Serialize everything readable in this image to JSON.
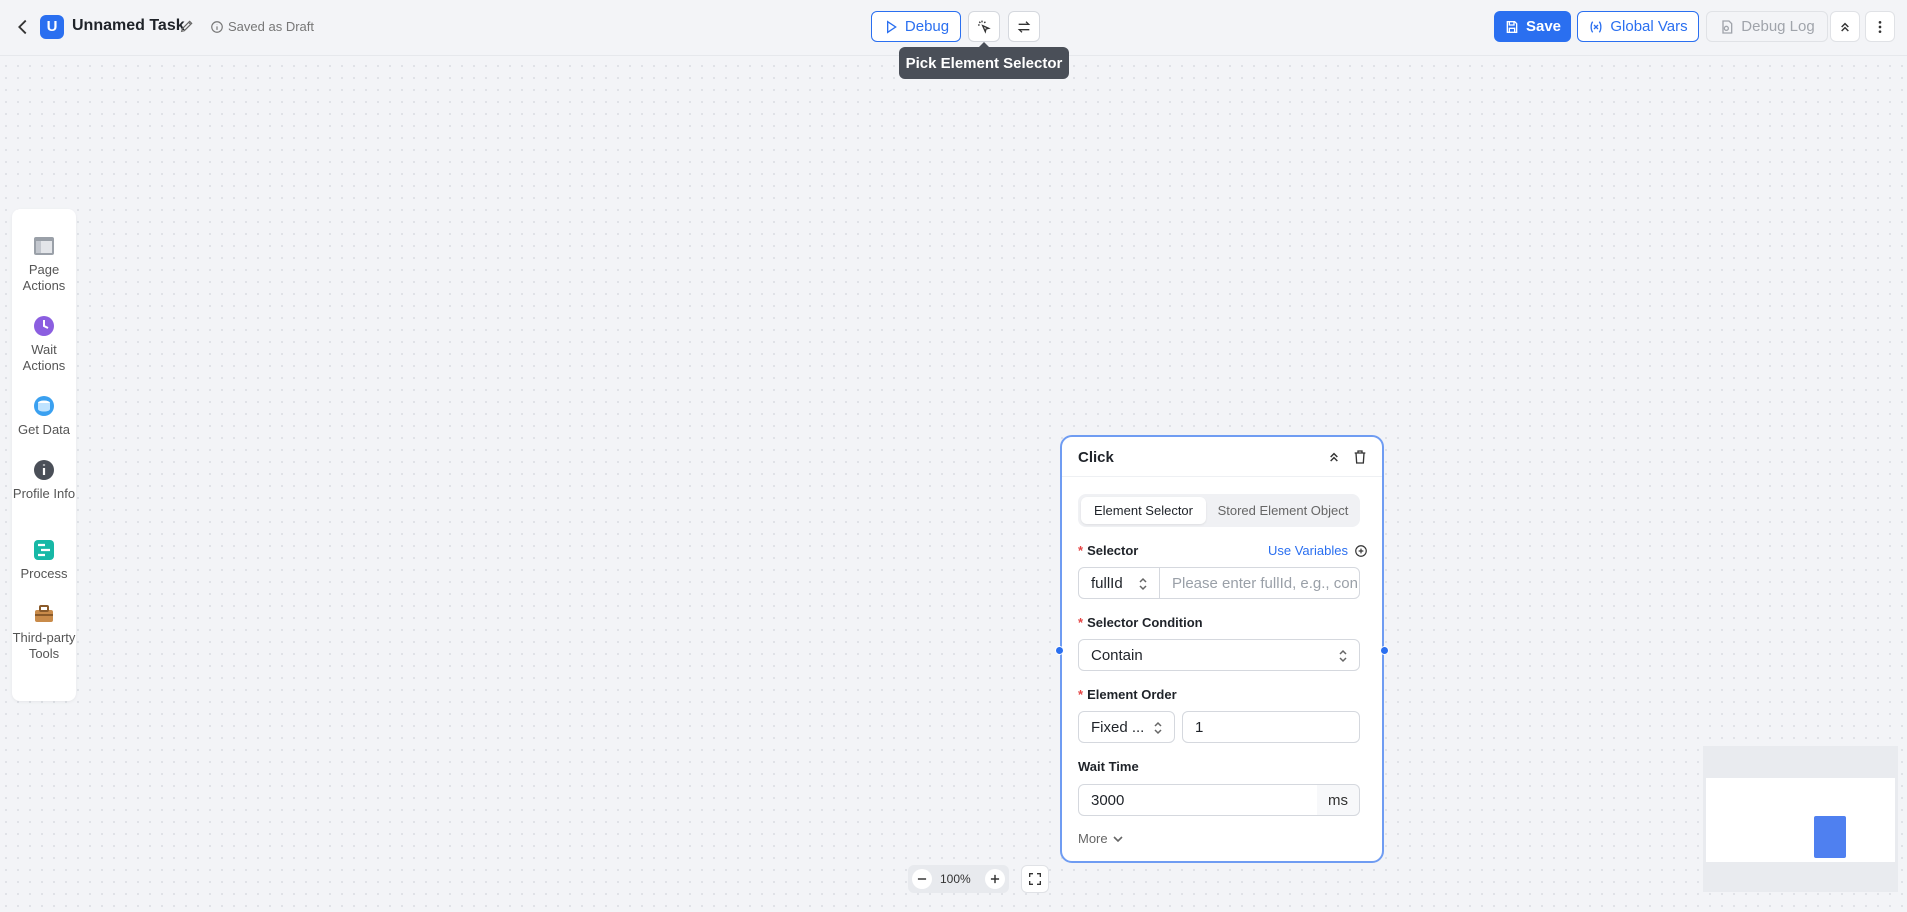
{
  "header": {
    "app_initial": "U",
    "task_title": "Unnamed Task",
    "saved_status": "Saved as Draft",
    "debug_label": "Debug",
    "tooltip": "Pick Element Selector",
    "save_label": "Save",
    "global_vars_label": "Global Vars",
    "debug_log_label": "Debug Log"
  },
  "toolbox": {
    "items": [
      {
        "label": "Page Actions",
        "icon": "page-icon"
      },
      {
        "label": "Wait Actions",
        "icon": "clock-icon"
      },
      {
        "label": "Get Data",
        "icon": "database-icon"
      },
      {
        "label": "Profile Info",
        "icon": "info-icon"
      },
      {
        "label": "Process",
        "icon": "process-icon"
      },
      {
        "label": "Third-party Tools",
        "icon": "toolbox-icon"
      }
    ]
  },
  "node": {
    "title": "Click",
    "tabs": [
      "Element Selector",
      "Stored Element Object"
    ],
    "active_tab": "Element Selector",
    "selector": {
      "label": "Selector",
      "use_variables": "Use Variables",
      "type_value": "fullId",
      "placeholder": "Please enter fullId, e.g., con"
    },
    "condition": {
      "label": "Selector Condition",
      "value": "Contain"
    },
    "order": {
      "label": "Element Order",
      "mode": "Fixed ...",
      "value": "1"
    },
    "wait": {
      "label": "Wait Time",
      "value": "3000",
      "unit": "ms"
    },
    "more_label": "More"
  },
  "zoom": {
    "level": "100%"
  },
  "colors": {
    "accent": "#2a6ff0",
    "canvas": "#f3f4f7",
    "required": "#e54545"
  }
}
